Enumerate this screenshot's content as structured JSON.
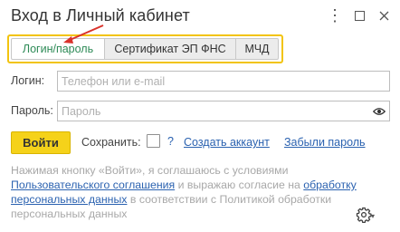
{
  "window": {
    "title": "Вход в Личный кабинет",
    "menu_icon": "kebab-menu-icon",
    "maximize_icon": "maximize-icon",
    "close_icon": "close-icon"
  },
  "tabs": [
    {
      "label": "Логин/пароль",
      "active": true
    },
    {
      "label": "Сертификат ЭП ФНС",
      "active": false
    },
    {
      "label": "МЧД",
      "active": false
    }
  ],
  "form": {
    "login_label": "Логин:",
    "login_placeholder": "Телефон или e-mail",
    "login_value": "",
    "password_label": "Пароль:",
    "password_placeholder": "Пароль",
    "password_value": "",
    "eye_icon": "eye-icon"
  },
  "actions": {
    "login_button": "Войти",
    "save_label": "Сохранить:",
    "save_checked": false,
    "help": "?",
    "create_account": "Создать аккаунт",
    "forgot_password": "Забыли пароль"
  },
  "consent": {
    "part1": "Нажимая кнопку «Войти», я соглашаюсь с условиями ",
    "link1": "Пользовательского соглашения",
    "part2": " и выражаю согласие на ",
    "link2": "обработку персональных данных",
    "part3": " в соответствии с Политикой обработки персональных данных"
  },
  "footer": {
    "settings_icon": "gear-icon"
  },
  "colors": {
    "accent_yellow": "#f5d21a",
    "tab_frame": "#f2c40f",
    "link_blue": "#2b62b0",
    "active_tab_text": "#2e8b57",
    "annotation_arrow": "#d9322b"
  }
}
